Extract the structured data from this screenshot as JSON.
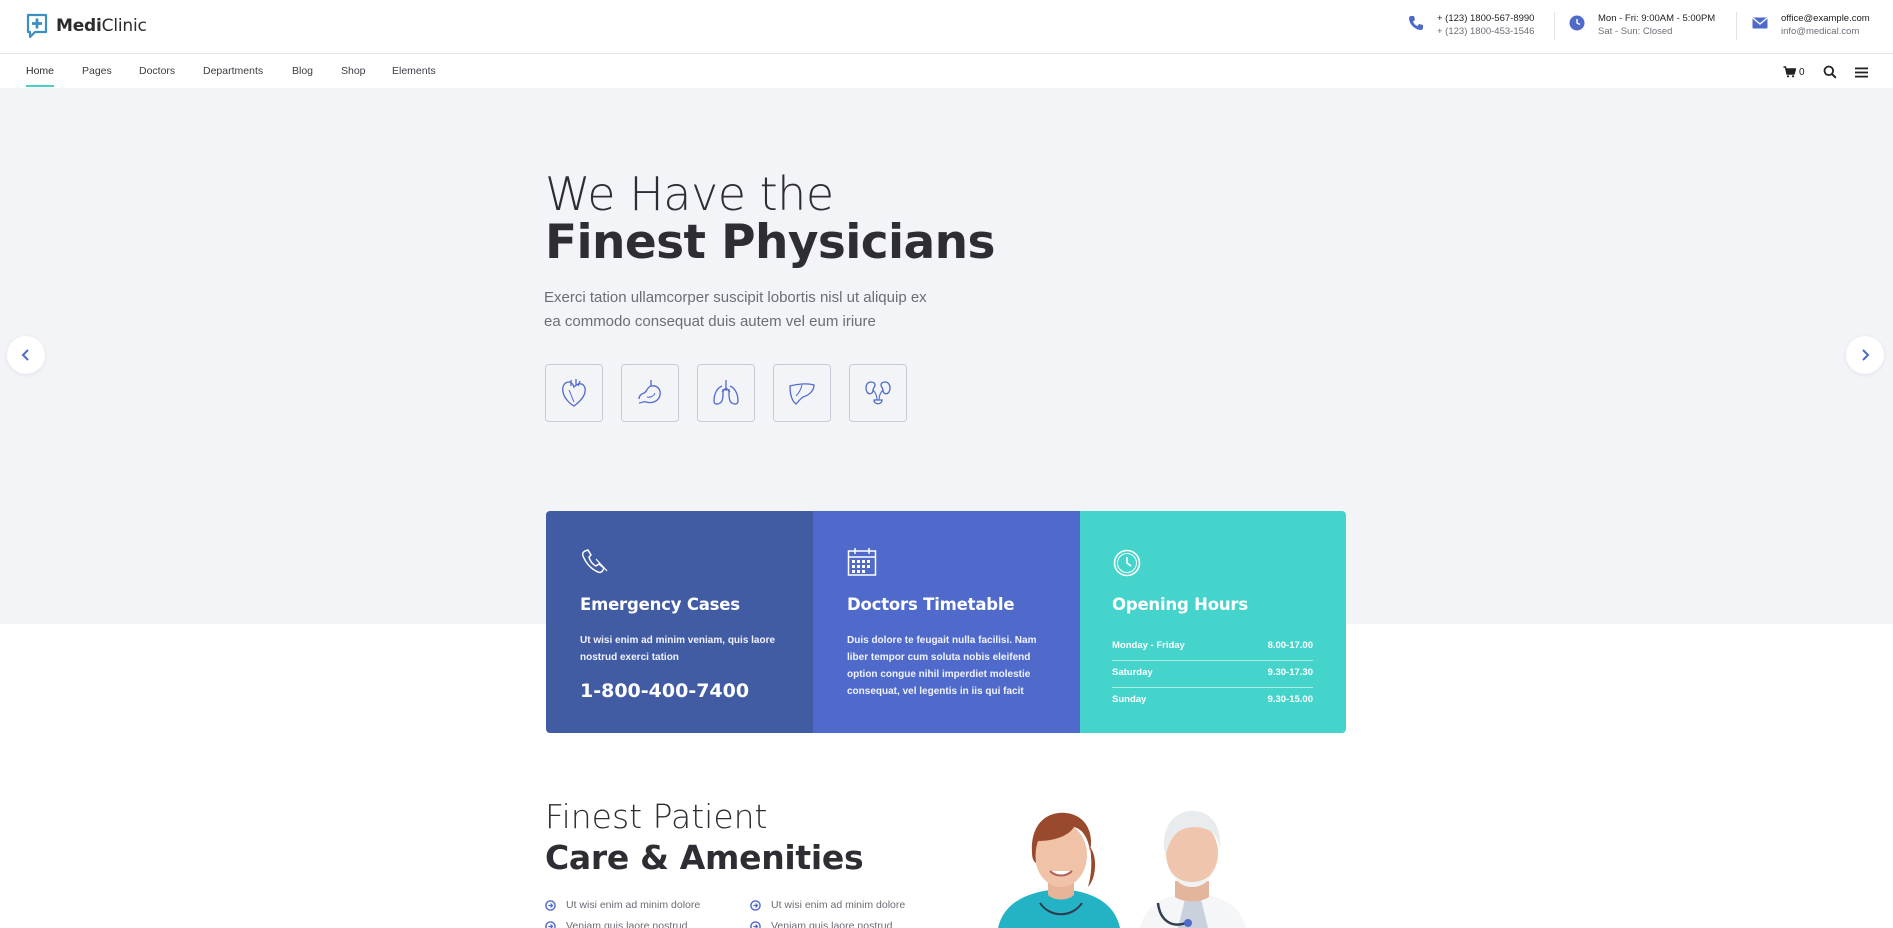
{
  "brand": {
    "name_bold": "Medi",
    "name_light": "Clinic"
  },
  "contacts": [
    {
      "icon": "phone-icon",
      "line1": "+ (123) 1800-567-8990",
      "line2": "+ (123) 1800-453-1546"
    },
    {
      "icon": "clock-icon",
      "line1": "Mon - Fri: 9:00AM - 5:00PM",
      "line2": "Sat - Sun: Closed"
    },
    {
      "icon": "mail-icon",
      "line1": "office@example.com",
      "line2": "info@medical.com"
    }
  ],
  "nav": {
    "items": [
      "Home",
      "Pages",
      "Doctors",
      "Departments",
      "Blog",
      "Shop",
      "Elements"
    ],
    "active": "Home",
    "cart_count": "0"
  },
  "hero": {
    "title_light": "We Have the",
    "title_bold": "Finest Physicians",
    "text_line1": "Exerci tation ullamcorper suscipit lobortis nisl ut aliquip ex",
    "text_line2": "ea commodo consequat duis autem vel eum iriure",
    "organ_icons": [
      "heart-icon",
      "stomach-icon",
      "lungs-icon",
      "liver-icon",
      "kidneys-icon"
    ]
  },
  "cards": {
    "emergency": {
      "title": "Emergency Cases",
      "text": "Ut wisi enim ad minim veniam, quis laore nostrud exerci tation",
      "phone": "1-800-400-7400"
    },
    "timetable": {
      "title": "Doctors Timetable",
      "text": "Duis dolore te feugait nulla facilisi. Nam liber tempor cum soluta nobis eleifend option congue nihil imperdiet molestie consequat, vel legentis in iis qui facit"
    },
    "hours": {
      "title": "Opening Hours",
      "rows": [
        {
          "day": "Monday - Friday",
          "time": "8.00-17.00"
        },
        {
          "day": "Saturday",
          "time": "9.30-17.30"
        },
        {
          "day": "Sunday",
          "time": "9.30-15.00"
        }
      ]
    }
  },
  "care": {
    "title_light": "Finest Patient",
    "title_bold": "Care & Amenities",
    "bullets": [
      "Ut wisi enim ad minim dolore",
      "Ut wisi enim ad minim dolore",
      "Veniam quis laore nostrud",
      "Veniam quis laore nostrud"
    ]
  },
  "colors": {
    "accent_teal": "#45d4cb",
    "navy": "#425ca4",
    "blue": "#4f6acb"
  }
}
